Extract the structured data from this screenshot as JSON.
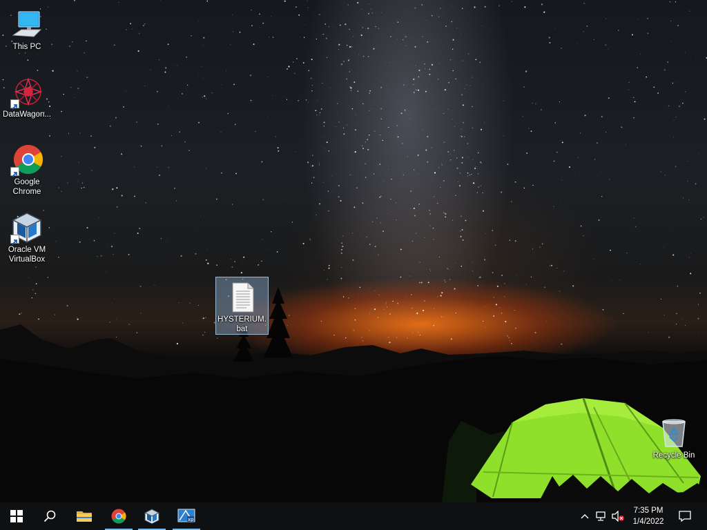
{
  "desktop": {
    "icons": [
      {
        "label": "This PC"
      },
      {
        "label": "DataWagon..."
      },
      {
        "label": "Google Chrome"
      },
      {
        "label": "Oracle VM VirtualBox"
      },
      {
        "label": "HYSTERIUM.bat"
      },
      {
        "label": "Recycle Bin"
      }
    ]
  },
  "taskbar": {
    "clock": {
      "time": "7:35 PM",
      "date": "1/4/2022"
    }
  },
  "colors": {
    "accent": "#76b9ed",
    "tent": "#8fe02a",
    "horizon_glow": "#ff7a18"
  }
}
